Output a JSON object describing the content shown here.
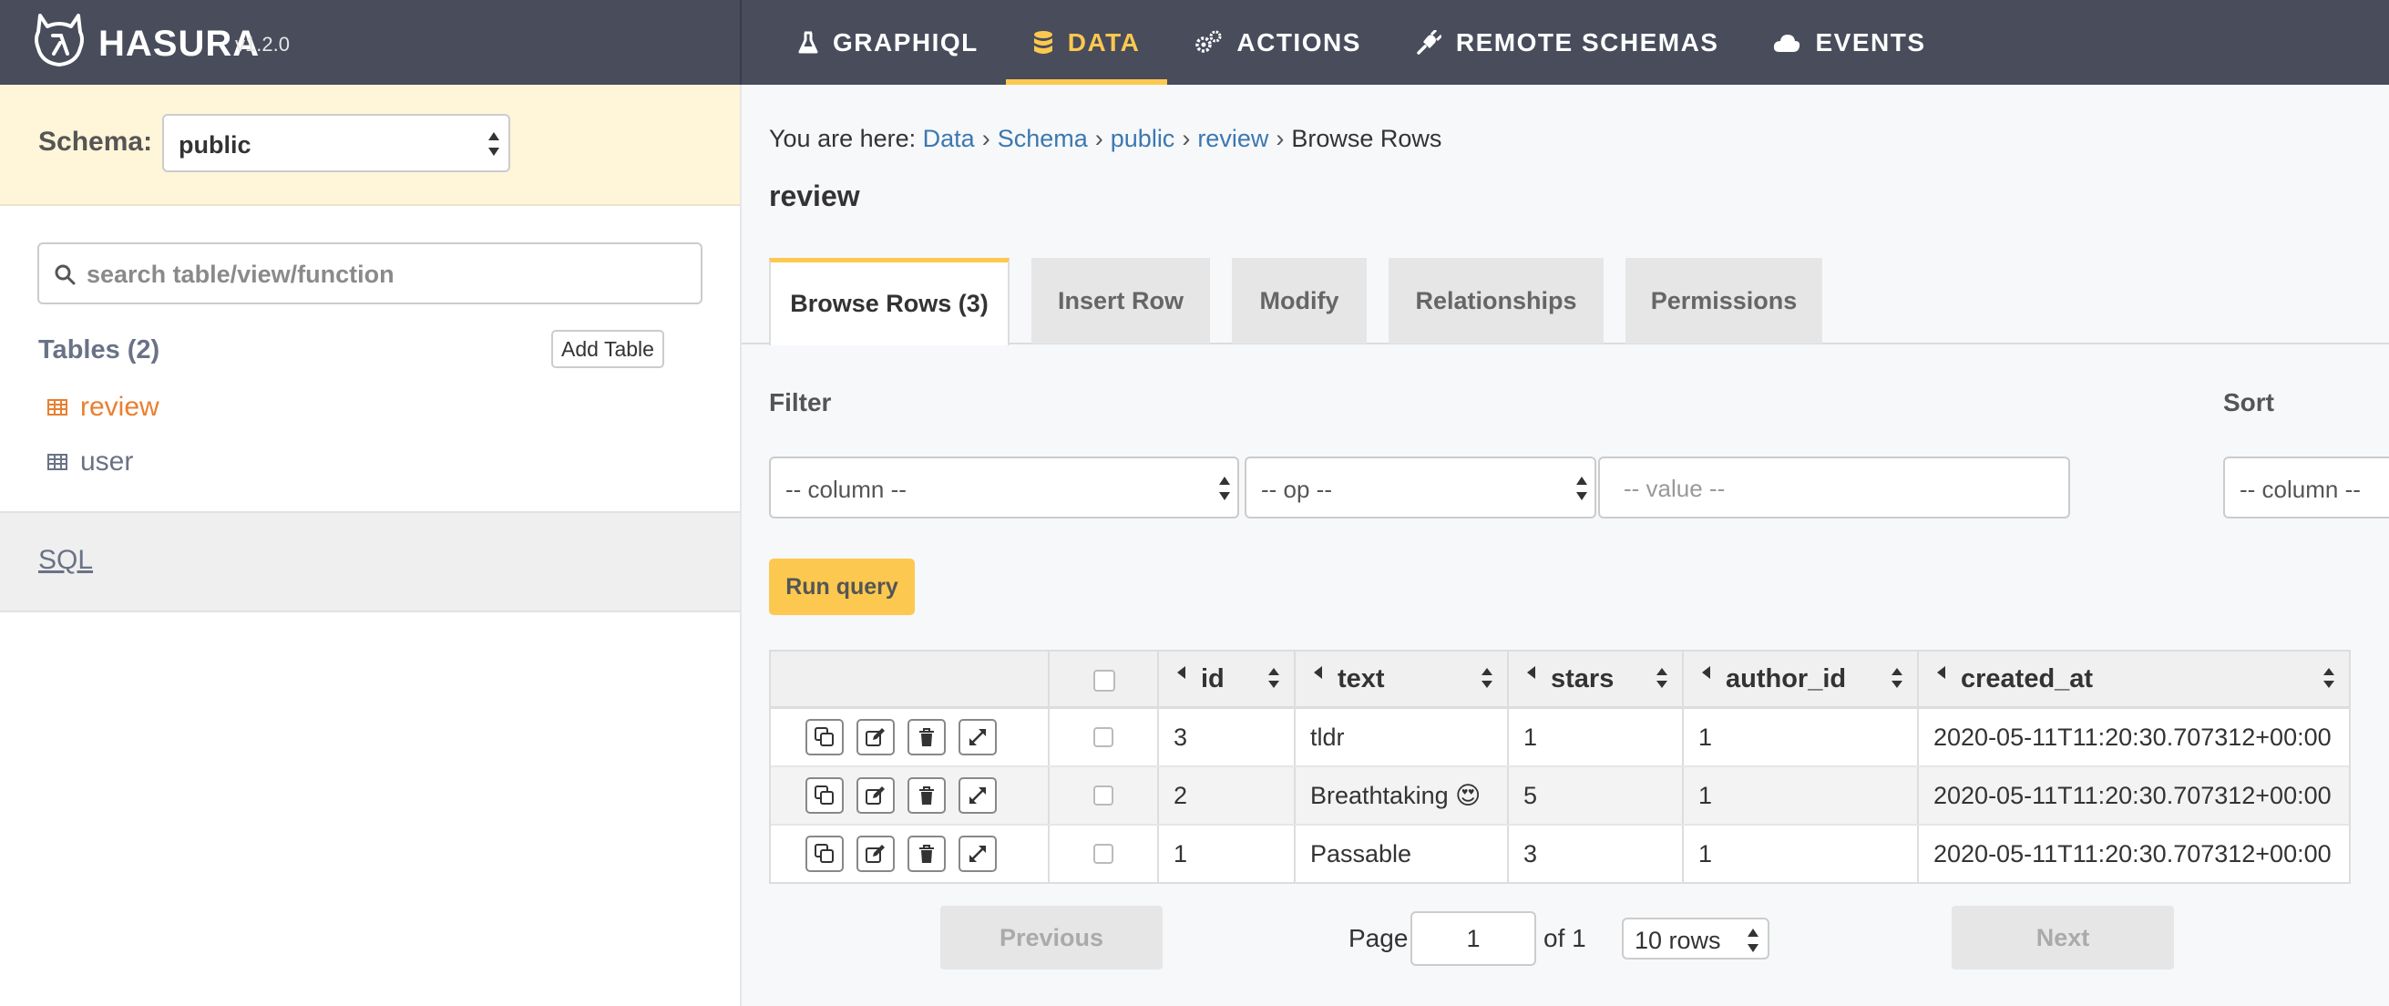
{
  "brand": {
    "name": "HASURA",
    "version": "v1.2.0"
  },
  "nav": [
    {
      "label": "GRAPHIQL",
      "icon": "flask-icon"
    },
    {
      "label": "DATA",
      "icon": "database-icon",
      "active": true
    },
    {
      "label": "ACTIONS",
      "icon": "cogs-icon"
    },
    {
      "label": "REMOTE SCHEMAS",
      "icon": "plug-icon"
    },
    {
      "label": "EVENTS",
      "icon": "cloud-icon"
    }
  ],
  "sidebar": {
    "schema_label": "Schema:",
    "schema_value": "public",
    "search_placeholder": "search table/view/function",
    "tables_heading": "Tables (2)",
    "add_table_label": "Add Table",
    "tables": [
      {
        "name": "review",
        "active": true
      },
      {
        "name": "user",
        "active": false
      }
    ],
    "sql_label": "SQL"
  },
  "breadcrumb": {
    "prefix": "You are here:",
    "items": [
      "Data",
      "Schema",
      "public",
      "review"
    ],
    "current": "Browse Rows"
  },
  "page_title": "review",
  "tabs": [
    "Browse Rows (3)",
    "Insert Row",
    "Modify",
    "Relationships",
    "Permissions"
  ],
  "filter": {
    "label": "Filter",
    "column_placeholder": "-- column --",
    "op_placeholder": "-- op --",
    "value_placeholder": "-- value --"
  },
  "sort": {
    "label": "Sort",
    "column_placeholder": "-- column --"
  },
  "run_query_label": "Run query",
  "table": {
    "columns": [
      "id",
      "text",
      "stars",
      "author_id",
      "created_at"
    ],
    "rows": [
      [
        "3",
        "tldr",
        "1",
        "1",
        "2020-05-11T11:20:30.707312+00:00"
      ],
      [
        "2",
        "Breathtaking 😍",
        "5",
        "1",
        "2020-05-11T11:20:30.707312+00:00"
      ],
      [
        "1",
        "Passable",
        "3",
        "1",
        "2020-05-11T11:20:30.707312+00:00"
      ]
    ]
  },
  "pagination": {
    "previous_label": "Previous",
    "next_label": "Next",
    "page_label": "Page",
    "page_value": "1",
    "of_label": "of 1",
    "rows_value": "10 rows"
  },
  "colors": {
    "accent": "#fcc84f",
    "topbar": "#484c5b",
    "link": "#3b78b0",
    "active_table": "#e97f2f"
  }
}
